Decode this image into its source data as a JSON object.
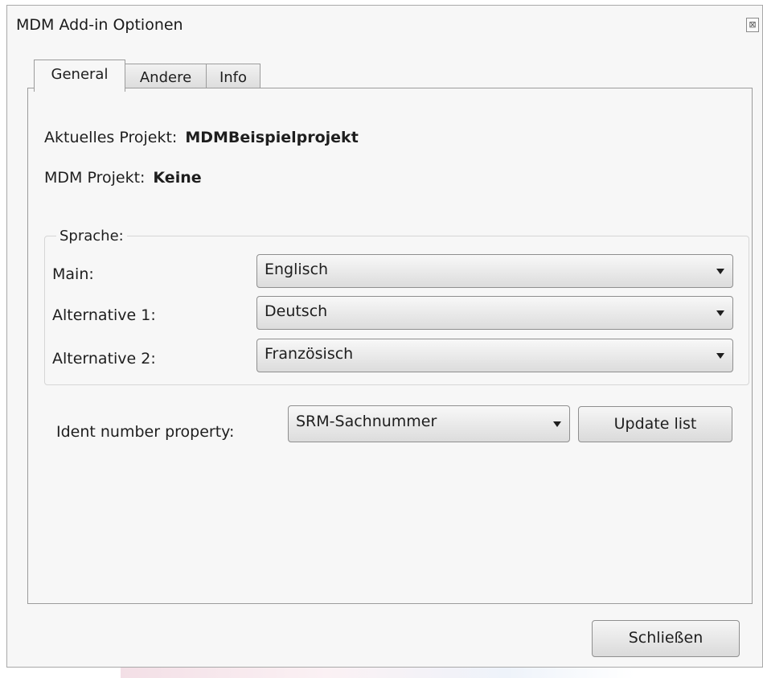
{
  "window": {
    "title": "MDM Add-in Optionen",
    "close_glyph": "⊠"
  },
  "tabs": [
    {
      "label": "General",
      "active": true
    },
    {
      "label": "Andere",
      "active": false
    },
    {
      "label": "Info",
      "active": false
    }
  ],
  "general": {
    "current_project_label": "Aktuelles Projekt:",
    "current_project_value": "MDMBeispielprojekt",
    "mdm_project_label": "MDM Projekt:",
    "mdm_project_value": "Keine",
    "language_group": {
      "caption": "Sprache:",
      "main_label": "Main:",
      "main_value": "Englisch",
      "alt1_label": "Alternative 1:",
      "alt1_value": "Deutsch",
      "alt2_label": "Alternative 2:",
      "alt2_value": "Französisch"
    },
    "ident_label": "Ident number property:",
    "ident_value": "SRM-Sachnummer",
    "update_button": "Update list"
  },
  "footer": {
    "close_button": "Schließen"
  }
}
